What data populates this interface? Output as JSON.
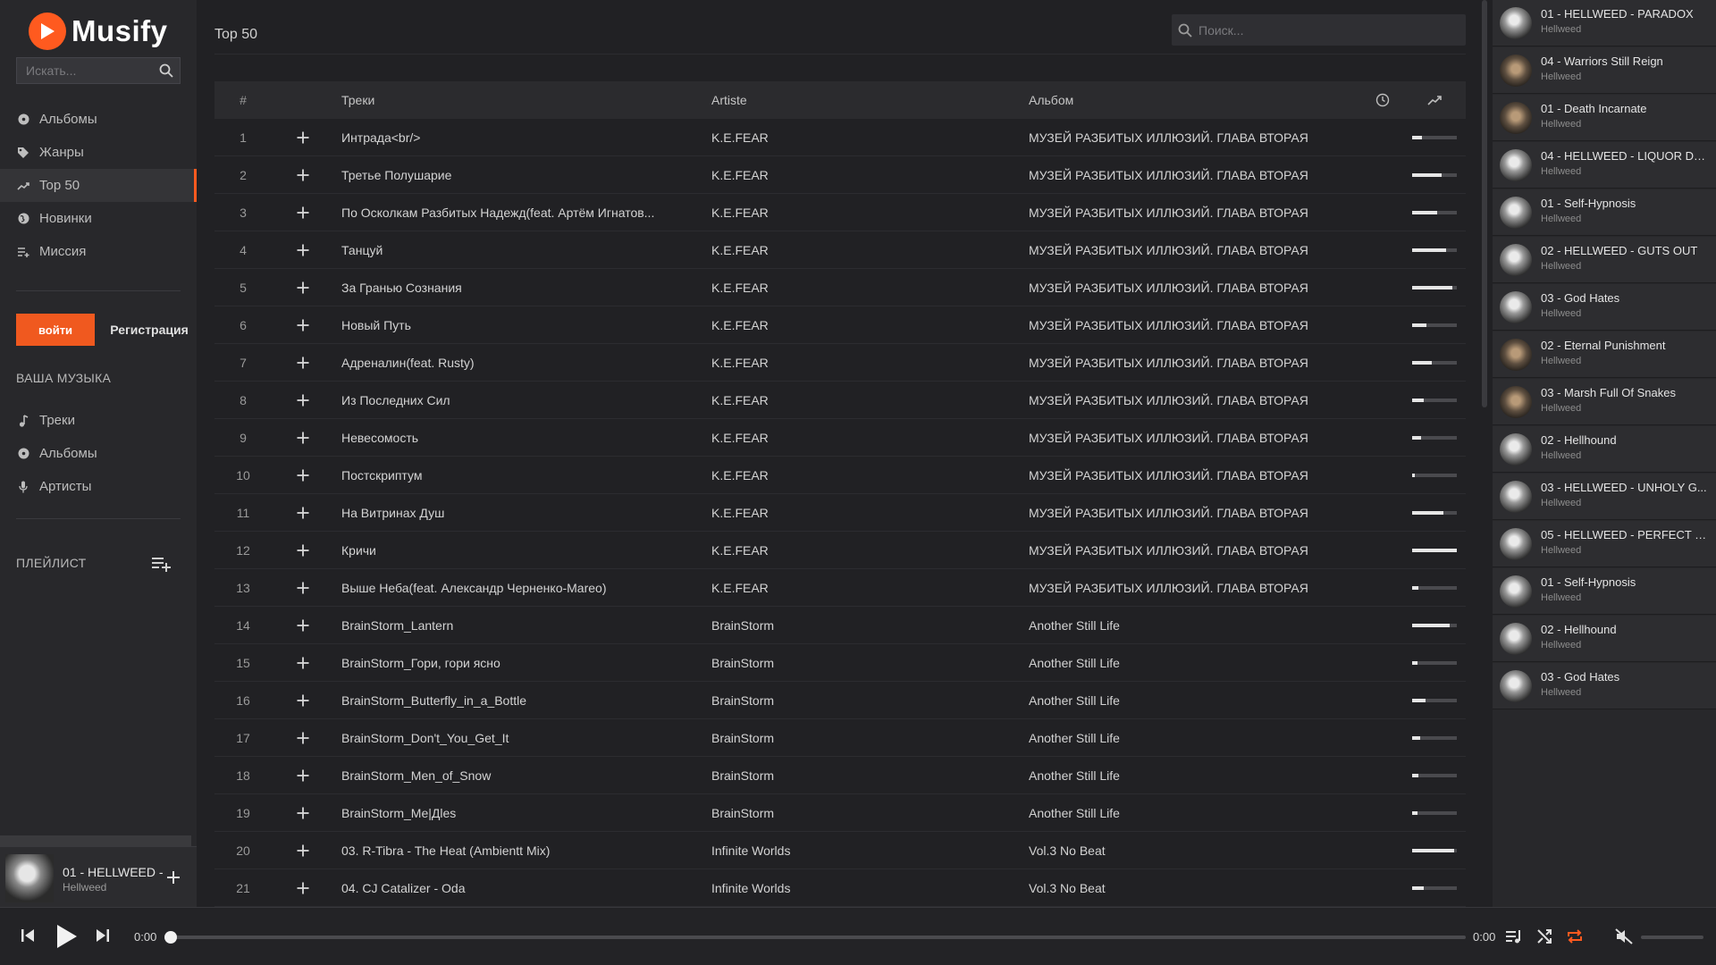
{
  "app": {
    "name": "Musify",
    "page_title": "Top 50",
    "accent_color": "#ff5a1f"
  },
  "sidebar": {
    "search_placeholder": "Искать...",
    "nav": [
      {
        "label": "Альбомы",
        "icon": "disc-icon",
        "active": false
      },
      {
        "label": "Жанры",
        "icon": "tag-icon",
        "active": false
      },
      {
        "label": "Top 50",
        "icon": "trending-icon",
        "active": true
      },
      {
        "label": "Новинки",
        "icon": "globe-icon",
        "active": false
      },
      {
        "label": "Миссия",
        "icon": "playlist-add-icon",
        "active": false
      }
    ],
    "login_label": "войти",
    "register_label": "Регистрация",
    "your_music_title": "ВАША МУЗЫКА",
    "library": [
      {
        "label": "Треки",
        "icon": "note-icon"
      },
      {
        "label": "Альбомы",
        "icon": "disc-icon"
      },
      {
        "label": "Артисты",
        "icon": "mic-icon"
      }
    ],
    "playlist_title": "ПЛЕЙЛИСТ"
  },
  "search": {
    "placeholder": "Поиск..."
  },
  "table": {
    "headers": {
      "num": "#",
      "title": "Треки",
      "artist": "Artiste",
      "album": "Альбом"
    },
    "rows": [
      {
        "n": "1",
        "title": "Интрада<br/>",
        "artist": "K.E.FEAR",
        "album": "МУЗЕЙ РАЗБИТЫХ ИЛЛЮЗИЙ. ГЛАВА ВТОРАЯ",
        "popularity": 0.22
      },
      {
        "n": "2",
        "title": "Третье Полушарие",
        "artist": "K.E.FEAR",
        "album": "МУЗЕЙ РАЗБИТЫХ ИЛЛЮЗИЙ. ГЛАВА ВТОРАЯ",
        "popularity": 0.66
      },
      {
        "n": "3",
        "title": "По Осколкам Разбитых Надежд(feat. Артём Игнатов...",
        "artist": "K.E.FEAR",
        "album": "МУЗЕЙ РАЗБИТЫХ ИЛЛЮЗИЙ. ГЛАВА ВТОРАЯ",
        "popularity": 0.56
      },
      {
        "n": "4",
        "title": "Танцуй",
        "artist": "K.E.FEAR",
        "album": "МУЗЕЙ РАЗБИТЫХ ИЛЛЮЗИЙ. ГЛАВА ВТОРАЯ",
        "popularity": 0.76
      },
      {
        "n": "5",
        "title": "За Гранью Сознания",
        "artist": "K.E.FEAR",
        "album": "МУЗЕЙ РАЗБИТЫХ ИЛЛЮЗИЙ. ГЛАВА ВТОРАЯ",
        "popularity": 0.9
      },
      {
        "n": "6",
        "title": "Новый Путь",
        "artist": "K.E.FEAR",
        "album": "МУЗЕЙ РАЗБИТЫХ ИЛЛЮЗИЙ. ГЛАВА ВТОРАЯ",
        "popularity": 0.32
      },
      {
        "n": "7",
        "title": "Адреналин(feat. Rusty)",
        "artist": "K.E.FEAR",
        "album": "МУЗЕЙ РАЗБИТЫХ ИЛЛЮЗИЙ. ГЛАВА ВТОРАЯ",
        "popularity": 0.44
      },
      {
        "n": "8",
        "title": "Из Последних Сил",
        "artist": "K.E.FEAR",
        "album": "МУЗЕЙ РАЗБИТЫХ ИЛЛЮЗИЙ. ГЛАВА ВТОРАЯ",
        "popularity": 0.26
      },
      {
        "n": "9",
        "title": "Невесомость",
        "artist": "K.E.FEAR",
        "album": "МУЗЕЙ РАЗБИТЫХ ИЛЛЮЗИЙ. ГЛАВА ВТОРАЯ",
        "popularity": 0.2
      },
      {
        "n": "10",
        "title": "Постскриптум",
        "artist": "K.E.FEAR",
        "album": "МУЗЕЙ РАЗБИТЫХ ИЛЛЮЗИЙ. ГЛАВА ВТОРАЯ",
        "popularity": 0.06
      },
      {
        "n": "11",
        "title": "На Витринах Душ",
        "artist": "K.E.FEAR",
        "album": "МУЗЕЙ РАЗБИТЫХ ИЛЛЮЗИЙ. ГЛАВА ВТОРАЯ",
        "popularity": 0.7
      },
      {
        "n": "12",
        "title": "Кричи",
        "artist": "K.E.FEAR",
        "album": "МУЗЕЙ РАЗБИТЫХ ИЛЛЮЗИЙ. ГЛАВА ВТОРАЯ",
        "popularity": 1.0
      },
      {
        "n": "13",
        "title": "Выше Неба(feat. Александр Черненко-Mareo)",
        "artist": "K.E.FEAR",
        "album": "МУЗЕЙ РАЗБИТЫХ ИЛЛЮЗИЙ. ГЛАВА ВТОРАЯ",
        "popularity": 0.14
      },
      {
        "n": "14",
        "title": "BrainStorm_Lantern",
        "artist": "BrainStorm",
        "album": "Another Still Life",
        "popularity": 0.84
      },
      {
        "n": "15",
        "title": "BrainStorm_Гори, гори ясно",
        "artist": "BrainStorm",
        "album": "Another Still Life",
        "popularity": 0.12
      },
      {
        "n": "16",
        "title": "BrainStorm_Butterfly_in_a_Bottle",
        "artist": "BrainStorm",
        "album": "Another Still Life",
        "popularity": 0.3
      },
      {
        "n": "17",
        "title": "BrainStorm_Don't_You_Get_It",
        "artist": "BrainStorm",
        "album": "Another Still Life",
        "popularity": 0.18
      },
      {
        "n": "18",
        "title": "BrainStorm_Men_of_Snow",
        "artist": "BrainStorm",
        "album": "Another Still Life",
        "popularity": 0.14
      },
      {
        "n": "19",
        "title": "BrainStorm_Me|Дles",
        "artist": "BrainStorm",
        "album": "Another Still Life",
        "popularity": 0.12
      },
      {
        "n": "20",
        "title": "03. R-Tibra - The Heat (Ambientt Mix)",
        "artist": "Infinite Worlds",
        "album": "Vol.3 No Beat",
        "popularity": 0.94
      },
      {
        "n": "21",
        "title": "04. CJ Catalizer - Oda",
        "artist": "Infinite Worlds",
        "album": "Vol.3 No Beat",
        "popularity": 0.26
      }
    ]
  },
  "queue": [
    {
      "title": "01 - HELLWEED - PARADOX",
      "artist": "Hellweed"
    },
    {
      "title": "04 - Warriors Still Reign",
      "artist": "Hellweed"
    },
    {
      "title": "01 - Death Incarnate",
      "artist": "Hellweed"
    },
    {
      "title": "04 - HELLWEED - LIQUOR DR...",
      "artist": "Hellweed"
    },
    {
      "title": "01 - Self-Hypnosis",
      "artist": "Hellweed"
    },
    {
      "title": "02 - HELLWEED - GUTS OUT",
      "artist": "Hellweed"
    },
    {
      "title": "03 - God Hates",
      "artist": "Hellweed"
    },
    {
      "title": "02 - Eternal Punishment",
      "artist": "Hellweed"
    },
    {
      "title": "03 - Marsh Full Of Snakes",
      "artist": "Hellweed"
    },
    {
      "title": "02 - Hellhound",
      "artist": "Hellweed"
    },
    {
      "title": "03 - HELLWEED - UNHOLY G...",
      "artist": "Hellweed"
    },
    {
      "title": "05 - HELLWEED - PERFECT E...",
      "artist": "Hellweed"
    },
    {
      "title": "01 - Self-Hypnosis",
      "artist": "Hellweed"
    },
    {
      "title": "02 - Hellhound",
      "artist": "Hellweed"
    },
    {
      "title": "03 - God Hates",
      "artist": "Hellweed"
    }
  ],
  "now_playing": {
    "title": "01 - HELLWEED -",
    "artist": "Hellweed"
  },
  "player": {
    "current_time": "0:00",
    "total_time": "0:00",
    "progress": 0.0,
    "repeat_active": true,
    "muted": true,
    "volume": 0.0
  }
}
